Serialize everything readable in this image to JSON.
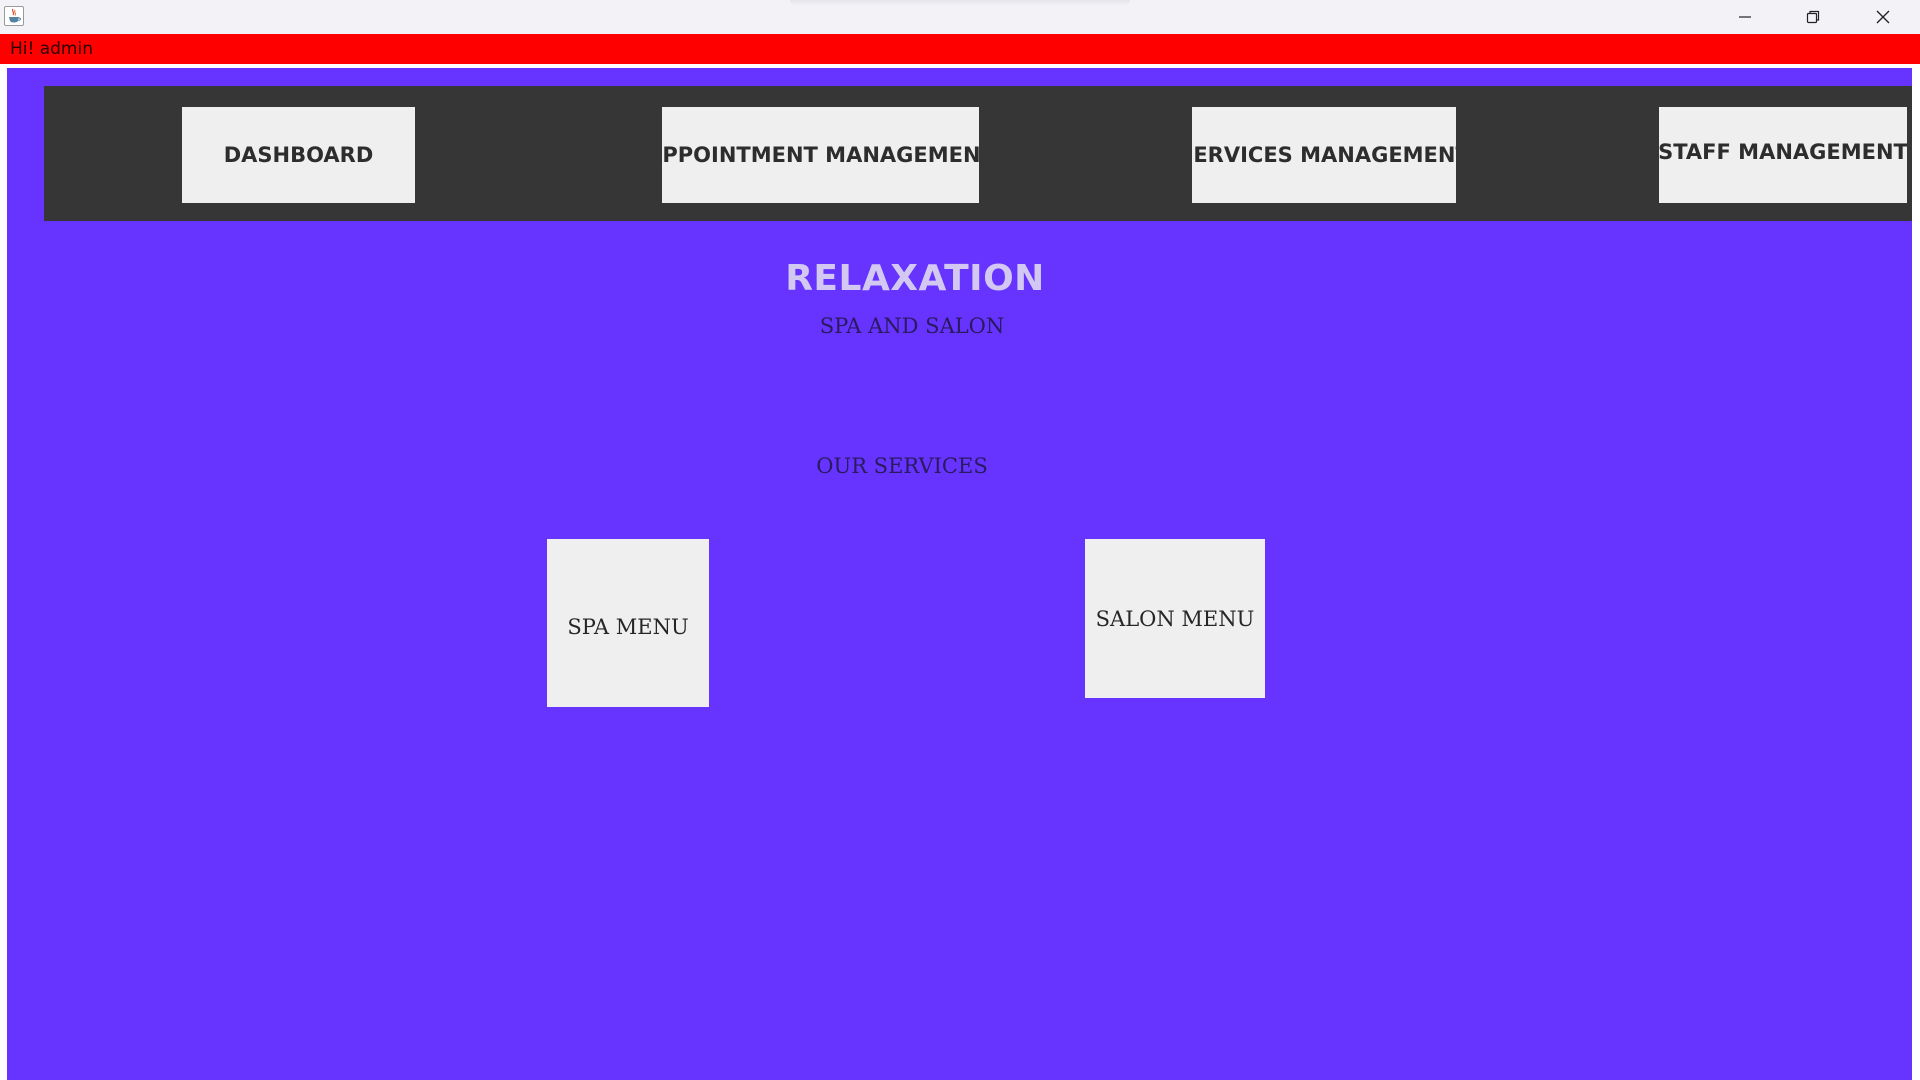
{
  "window": {
    "controls": {
      "minimize_icon": "minimize-icon",
      "maximize_icon": "restore-icon",
      "close_icon": "close-icon"
    }
  },
  "header": {
    "greeting": "Hi! admin"
  },
  "nav": {
    "items": [
      {
        "label": "DASHBOARD"
      },
      {
        "label": "APPOINTMENT MANAGEMENT"
      },
      {
        "label": "SERVICES MANAGEMENT"
      },
      {
        "label": "STAFF MANAGEMENT"
      }
    ]
  },
  "main": {
    "title": "RELAXATION",
    "subtitle": "SPA AND SALON",
    "services_heading": "OUR SERVICES",
    "services": [
      {
        "label": "SPA MENU"
      },
      {
        "label": "SALON MENU"
      }
    ]
  },
  "colors": {
    "greeting_bar": "#ff0000",
    "main_background": "#6633ff",
    "nav_background": "#363636",
    "button_background": "#efefef",
    "title_color": "#d2c8f2"
  }
}
